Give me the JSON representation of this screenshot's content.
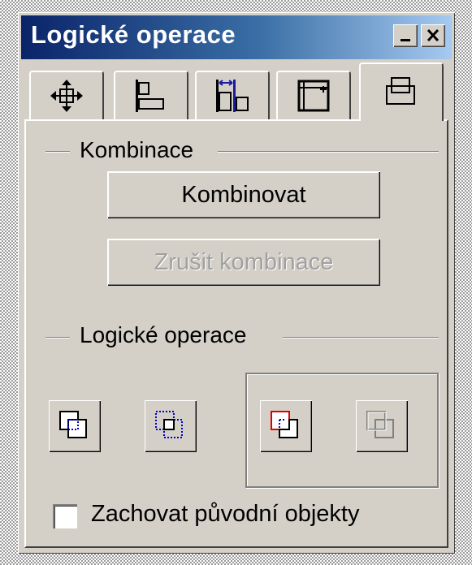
{
  "window": {
    "title": "Logické operace"
  },
  "tabs": [
    {
      "name": "transform",
      "icon": "move-icon"
    },
    {
      "name": "align",
      "icon": "align-left-icon"
    },
    {
      "name": "spacing",
      "icon": "distribute-icon"
    },
    {
      "name": "size",
      "icon": "resize-icon"
    },
    {
      "name": "logic",
      "icon": "combine-icon",
      "active": true
    }
  ],
  "combination": {
    "heading": "Kombinace",
    "combine_label": "Kombinovat",
    "uncombine_label": "Zrušit kombinace"
  },
  "logic": {
    "heading": "Logické operace",
    "buttons": [
      {
        "name": "union",
        "icon": "union-icon"
      },
      {
        "name": "intersection",
        "icon": "intersection-icon"
      },
      {
        "name": "subtract",
        "icon": "subtract-icon"
      },
      {
        "name": "exclude",
        "icon": "exclude-icon",
        "disabled": true
      }
    ]
  },
  "options": {
    "keep_originals_label": "Zachovat původní objekty",
    "keep_originals_checked": false
  },
  "colors": {
    "accent_red": "#e00000",
    "dotted_blue": "#0000cc"
  }
}
